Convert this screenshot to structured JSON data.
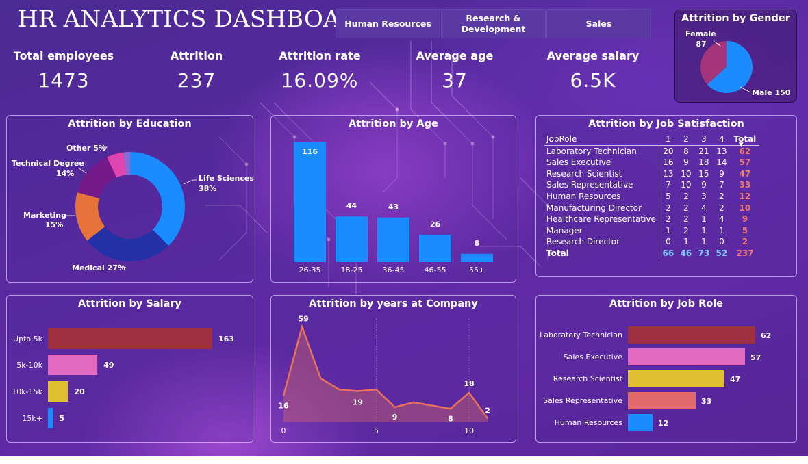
{
  "header": {
    "title": "HR ANALYTICS DASHBOARD"
  },
  "tabs": [
    {
      "label": "Human Resources"
    },
    {
      "label": "Research & Development"
    },
    {
      "label": "Sales"
    }
  ],
  "kpis": [
    {
      "label": "Total employees",
      "value": "1473"
    },
    {
      "label": "Attrition",
      "value": "237"
    },
    {
      "label": "Attrition rate",
      "value": "16.09%"
    },
    {
      "label": "Average age",
      "value": "37"
    },
    {
      "label": "Average salary",
      "value": "6.5K"
    }
  ],
  "colors": {
    "blue": "#1a8cff",
    "darkblue": "#2330a6",
    "orange": "#e8733a",
    "purple": "#74198a",
    "pink": "#e045b0",
    "lavender": "#8a6cd6",
    "maroon": "#9e3040",
    "rosepink": "#e46cc0",
    "mustard": "#e0c030",
    "salmon": "#e06a6a",
    "line": "#e8735a",
    "total": "#f07a6a"
  },
  "chart_data": [
    {
      "type": "pie",
      "title": "Attrition by Gender",
      "slices": [
        {
          "label": "Female",
          "value": 87,
          "color": "#a4357a"
        },
        {
          "label": "Male",
          "value": 150,
          "color": "#1a8cff"
        }
      ],
      "labels": [
        "Female",
        "87",
        "Male 150"
      ]
    },
    {
      "type": "pie",
      "title": "Attrition by Education",
      "slices": [
        {
          "label": "Life Sciences",
          "value": 38,
          "color": "#1a8cff"
        },
        {
          "label": "Medical",
          "value": 27,
          "color": "#2330a6"
        },
        {
          "label": "Marketing",
          "value": 15,
          "color": "#e8733a"
        },
        {
          "label": "Technical Degree",
          "value": 14,
          "color": "#74198a"
        },
        {
          "label": "Other",
          "value": 5,
          "color": "#e045b0"
        },
        {
          "label": "",
          "value": 2,
          "color": "#8a6cd6"
        }
      ],
      "labels": [
        "Life Sciences",
        "38%",
        "Medical 27%",
        "Marketing",
        "15%",
        "Technical Degree",
        "14%",
        "Other 5%"
      ]
    },
    {
      "type": "bar",
      "title": "Attrition by Age",
      "categories": [
        "26-35",
        "18-25",
        "36-45",
        "46-55",
        "55+"
      ],
      "values": [
        116,
        44,
        43,
        26,
        8
      ],
      "color": "#1a8cff"
    },
    {
      "type": "table",
      "title": "Attrition by Job Satisfaction",
      "columns": [
        "JobRole",
        "1",
        "2",
        "3",
        "4",
        "Total"
      ],
      "rows": [
        [
          "Laboratory Technician",
          "20",
          "8",
          "21",
          "13",
          "62"
        ],
        [
          "Sales Executive",
          "16",
          "9",
          "18",
          "14",
          "57"
        ],
        [
          "Research Scientist",
          "13",
          "10",
          "15",
          "9",
          "47"
        ],
        [
          "Sales Representative",
          "7",
          "10",
          "9",
          "7",
          "33"
        ],
        [
          "Human Resources",
          "5",
          "2",
          "3",
          "2",
          "12"
        ],
        [
          "Manufacturing Director",
          "2",
          "2",
          "4",
          "2",
          "10"
        ],
        [
          "Healthcare Representative",
          "2",
          "2",
          "1",
          "4",
          "9"
        ],
        [
          "Manager",
          "1",
          "2",
          "1",
          "1",
          "5"
        ],
        [
          "Research Director",
          "0",
          "1",
          "1",
          "0",
          "2"
        ]
      ],
      "total_row": [
        "Total",
        "66",
        "46",
        "73",
        "52",
        "237"
      ],
      "sort_indicator": "▼"
    },
    {
      "type": "bar",
      "orientation": "horizontal",
      "title": "Attrition by Salary",
      "categories": [
        "Upto 5k",
        "5k-10k",
        "10k-15k",
        "15k+"
      ],
      "values": [
        163,
        49,
        20,
        5
      ],
      "colors": [
        "#9e3040",
        "#e46cc0",
        "#e0c030",
        "#1a8cff"
      ]
    },
    {
      "type": "area",
      "title": "Attrition by years at Company",
      "x": [
        0,
        1,
        2,
        3,
        4,
        5,
        6,
        7,
        8,
        9,
        10,
        11
      ],
      "y": [
        16,
        59,
        27,
        20,
        19,
        20,
        9,
        12,
        10,
        8,
        18,
        2
      ],
      "point_labels": [
        {
          "x": 0,
          "label": "16"
        },
        {
          "x": 1,
          "label": "59"
        },
        {
          "x": 4,
          "label": "19"
        },
        {
          "x": 6,
          "label": "9"
        },
        {
          "x": 9,
          "label": "8"
        },
        {
          "x": 10,
          "label": "18"
        },
        {
          "x": 11,
          "label": "2"
        }
      ],
      "x_ticks": [
        0,
        5,
        10
      ],
      "xlim": [
        0,
        11
      ],
      "ylim": [
        0,
        64
      ]
    },
    {
      "type": "bar",
      "orientation": "horizontal",
      "title": "Attrition by Job Role",
      "categories": [
        "Laboratory Technician",
        "Sales Executive",
        "Research Scientist",
        "Sales Representative",
        "Human Resources"
      ],
      "values": [
        62,
        57,
        47,
        33,
        12
      ],
      "colors": [
        "#9e3040",
        "#e46cc0",
        "#e0c030",
        "#e06a6a",
        "#1a8cff"
      ]
    }
  ]
}
